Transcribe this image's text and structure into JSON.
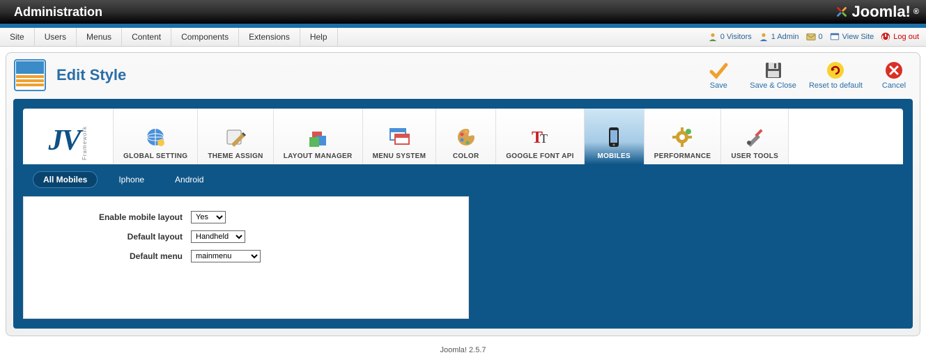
{
  "header": {
    "title": "Administration",
    "brand": "Joomla!"
  },
  "menubar": {
    "items": [
      "Site",
      "Users",
      "Menus",
      "Content",
      "Components",
      "Extensions",
      "Help"
    ],
    "status": {
      "visitors": "0 Visitors",
      "admins": "1 Admin",
      "messages": "0",
      "view_site": "View Site",
      "log_out": "Log out"
    }
  },
  "page": {
    "title": "Edit Style"
  },
  "toolbar": {
    "save": "Save",
    "save_close": "Save & Close",
    "reset": "Reset to default",
    "cancel": "Cancel"
  },
  "framework": {
    "logo_main": "JV",
    "logo_sub": "Framework",
    "tabs": [
      {
        "label": "GLOBAL SETTING",
        "icon": "globe"
      },
      {
        "label": "THEME ASSIGN",
        "icon": "theme"
      },
      {
        "label": "LAYOUT MANAGER",
        "icon": "layout"
      },
      {
        "label": "MENU SYSTEM",
        "icon": "menu"
      },
      {
        "label": "COLOR",
        "icon": "palette"
      },
      {
        "label": "GOOGLE FONT API",
        "icon": "font"
      },
      {
        "label": "MOBILES",
        "icon": "mobile",
        "active": true
      },
      {
        "label": "PERFORMANCE",
        "icon": "gear"
      },
      {
        "label": "USER TOOLS",
        "icon": "tools"
      }
    ],
    "subtabs": [
      {
        "label": "All Mobiles",
        "active": true
      },
      {
        "label": "Iphone"
      },
      {
        "label": "Android"
      }
    ]
  },
  "form": {
    "enable_mobile": {
      "label": "Enable mobile layout",
      "value": "Yes"
    },
    "default_layout": {
      "label": "Default layout",
      "value": "Handheld"
    },
    "default_menu": {
      "label": "Default menu",
      "value": "mainmenu"
    }
  },
  "footer": {
    "version": "Joomla! 2.5.7"
  }
}
